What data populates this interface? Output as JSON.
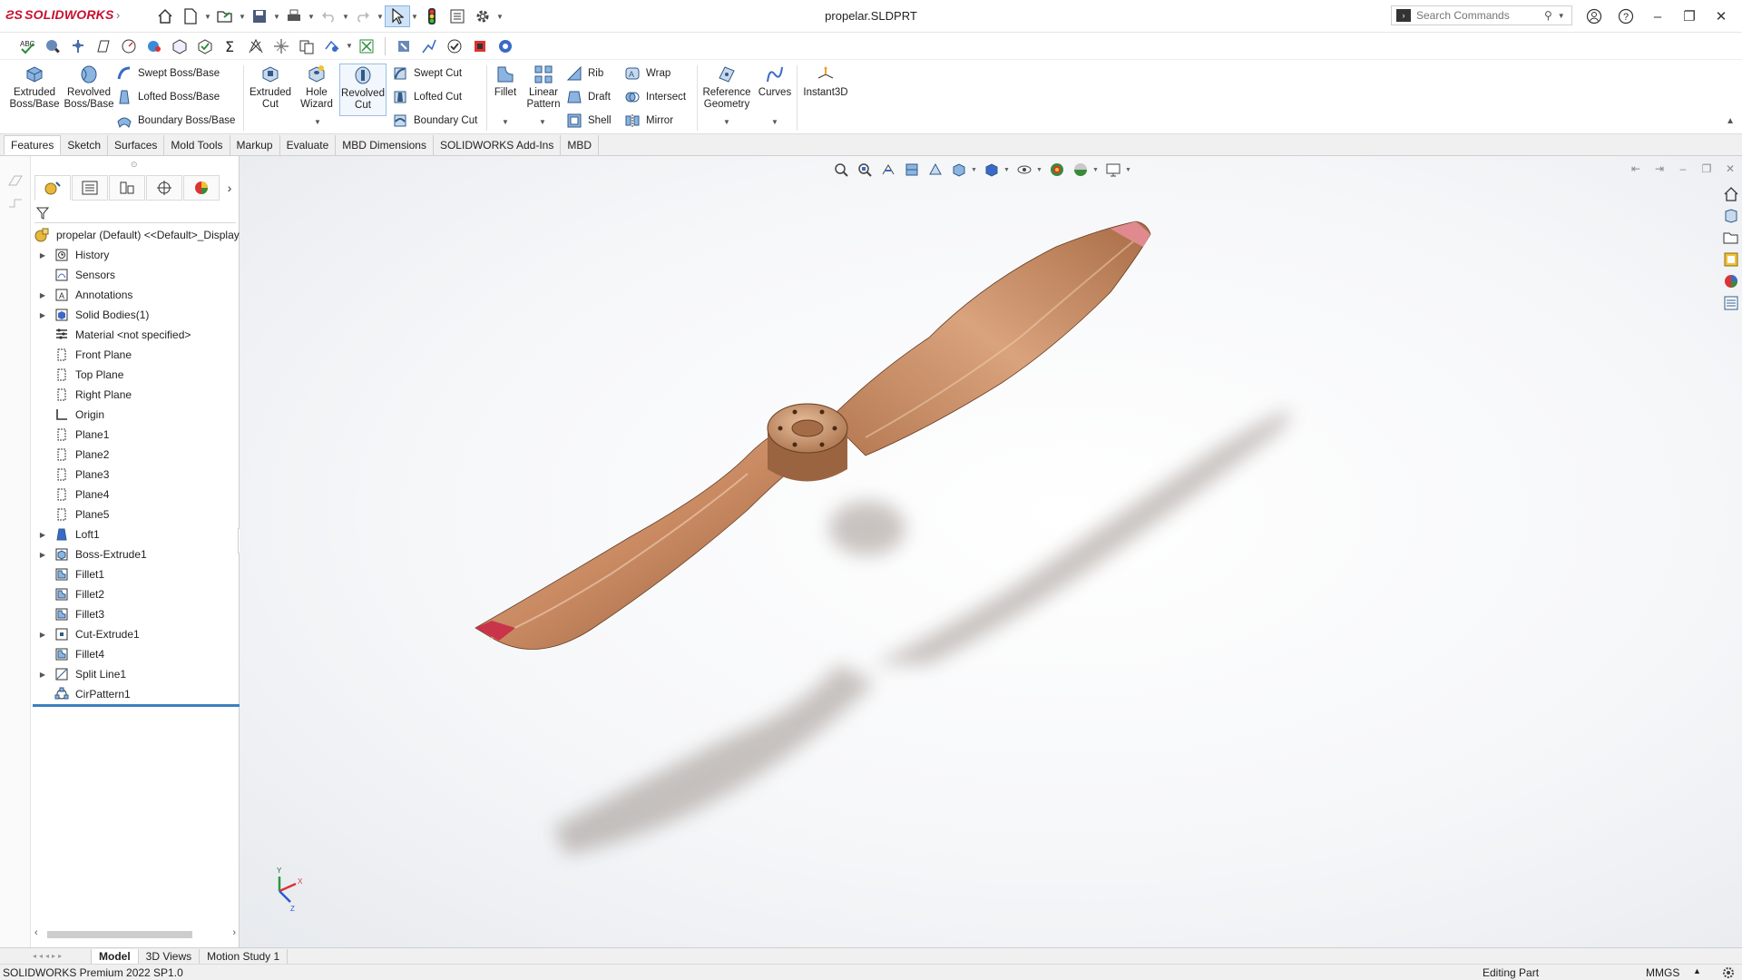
{
  "app": {
    "brand": "SOLIDWORKS",
    "doc_title": "propelar.SLDPRT",
    "search_placeholder": "Search Commands"
  },
  "command_manager": {
    "extruded_boss": "Extruded\nBoss/Base",
    "revolved_boss": "Revolved\nBoss/Base",
    "swept_boss": "Swept Boss/Base",
    "lofted_boss": "Lofted Boss/Base",
    "boundary_boss": "Boundary Boss/Base",
    "extruded_cut": "Extruded\nCut",
    "hole_wizard": "Hole\nWizard",
    "revolved_cut": "Revolved\nCut",
    "swept_cut": "Swept Cut",
    "lofted_cut": "Lofted Cut",
    "boundary_cut": "Boundary Cut",
    "fillet": "Fillet",
    "linear_pattern": "Linear\nPattern",
    "rib": "Rib",
    "draft": "Draft",
    "shell": "Shell",
    "wrap": "Wrap",
    "intersect": "Intersect",
    "mirror": "Mirror",
    "reference_geometry": "Reference\nGeometry",
    "curves": "Curves",
    "instant3d": "Instant3D"
  },
  "tabs": [
    "Features",
    "Sketch",
    "Surfaces",
    "Mold Tools",
    "Markup",
    "Evaluate",
    "MBD Dimensions",
    "SOLIDWORKS Add-Ins",
    "MBD"
  ],
  "active_tab": "Features",
  "feature_tree": {
    "root": "propelar (Default) <<Default>_Display",
    "items": [
      {
        "label": "History",
        "expandable": true,
        "icon": "history-icon"
      },
      {
        "label": "Sensors",
        "expandable": false,
        "icon": "sensors-icon"
      },
      {
        "label": "Annotations",
        "expandable": true,
        "icon": "annotations-icon"
      },
      {
        "label": "Solid Bodies(1)",
        "expandable": true,
        "icon": "solid-bodies-icon"
      },
      {
        "label": "Material <not specified>",
        "expandable": false,
        "icon": "material-icon"
      },
      {
        "label": "Front Plane",
        "expandable": false,
        "icon": "plane-icon"
      },
      {
        "label": "Top Plane",
        "expandable": false,
        "icon": "plane-icon"
      },
      {
        "label": "Right Plane",
        "expandable": false,
        "icon": "plane-icon"
      },
      {
        "label": "Origin",
        "expandable": false,
        "icon": "origin-icon"
      },
      {
        "label": "Plane1",
        "expandable": false,
        "icon": "plane-icon"
      },
      {
        "label": "Plane2",
        "expandable": false,
        "icon": "plane-icon"
      },
      {
        "label": "Plane3",
        "expandable": false,
        "icon": "plane-icon"
      },
      {
        "label": "Plane4",
        "expandable": false,
        "icon": "plane-icon"
      },
      {
        "label": "Plane5",
        "expandable": false,
        "icon": "plane-icon"
      },
      {
        "label": "Loft1",
        "expandable": true,
        "icon": "loft-icon"
      },
      {
        "label": "Boss-Extrude1",
        "expandable": true,
        "icon": "extrude-icon"
      },
      {
        "label": "Fillet1",
        "expandable": false,
        "icon": "fillet-icon"
      },
      {
        "label": "Fillet2",
        "expandable": false,
        "icon": "fillet-icon"
      },
      {
        "label": "Fillet3",
        "expandable": false,
        "icon": "fillet-icon"
      },
      {
        "label": "Cut-Extrude1",
        "expandable": true,
        "icon": "cut-extrude-icon"
      },
      {
        "label": "Fillet4",
        "expandable": false,
        "icon": "fillet-icon"
      },
      {
        "label": "Split Line1",
        "expandable": true,
        "icon": "split-line-icon"
      },
      {
        "label": "CirPattern1",
        "expandable": false,
        "icon": "circular-pattern-icon"
      }
    ]
  },
  "bottom_tabs": [
    "Model",
    "3D Views",
    "Motion Study 1"
  ],
  "active_bottom_tab": "Model",
  "status": {
    "product": "SOLIDWORKS Premium 2022 SP1.0",
    "mode": "Editing Part",
    "units": "MMGS"
  },
  "triad": {
    "x": "X",
    "y": "Y",
    "z": "Z"
  },
  "colors": {
    "accent": "#3a7fc1",
    "brand": "#c8102e",
    "wood": "#c98a62",
    "tip": "#c9344a"
  }
}
